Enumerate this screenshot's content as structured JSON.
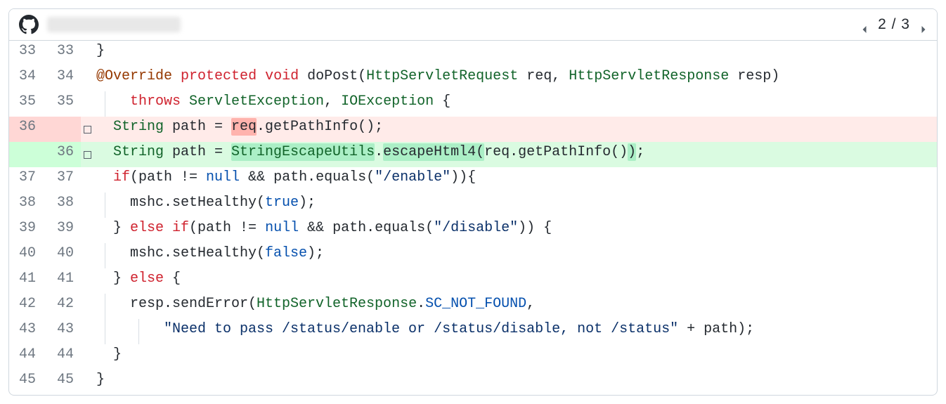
{
  "header": {
    "repo_label": "",
    "pager_prev": "◀",
    "pager_text": "2 / 3",
    "pager_next": "▶"
  },
  "code": {
    "rows": [
      {
        "old": "33",
        "new": "33",
        "type": "ctx",
        "indent": 0,
        "guides": [],
        "tokens": [
          [
            "plain",
            "}"
          ]
        ]
      },
      {
        "old": "34",
        "new": "34",
        "type": "ctx",
        "indent": 0,
        "guides": [],
        "tokens": [
          [
            "ann",
            "@Override"
          ],
          [
            "plain",
            " "
          ],
          [
            "kw",
            "protected"
          ],
          [
            "plain",
            " "
          ],
          [
            "kw",
            "void"
          ],
          [
            "plain",
            " "
          ],
          [
            "fn",
            "doPost"
          ],
          [
            "plain",
            "("
          ],
          [
            "type",
            "HttpServletRequest"
          ],
          [
            "plain",
            " req, "
          ],
          [
            "type",
            "HttpServletResponse"
          ],
          [
            "plain",
            " resp)"
          ]
        ]
      },
      {
        "old": "35",
        "new": "35",
        "type": "ctx",
        "indent": 2,
        "guides": [
          1
        ],
        "tokens": [
          [
            "kw",
            "throws"
          ],
          [
            "plain",
            " "
          ],
          [
            "type",
            "ServletException"
          ],
          [
            "plain",
            ", "
          ],
          [
            "type",
            "IOException"
          ],
          [
            "plain",
            " {"
          ]
        ]
      },
      {
        "old": "36",
        "new": "",
        "type": "del",
        "marker": true,
        "indent": 1,
        "guides": [],
        "tokens": [
          [
            "type",
            "String"
          ],
          [
            "plain",
            " path = "
          ],
          [
            "wdel",
            "req"
          ],
          [
            "plain",
            ".getPathInfo();"
          ]
        ]
      },
      {
        "old": "",
        "new": "36",
        "type": "add",
        "marker": true,
        "indent": 1,
        "guides": [],
        "tokens": [
          [
            "type",
            "String"
          ],
          [
            "plain",
            " path = "
          ],
          [
            "wadd_type",
            "StringEscapeUtils"
          ],
          [
            "plain",
            "."
          ],
          [
            "wadd",
            "escapeHtml4("
          ],
          [
            "plain",
            "req.getPathInfo()"
          ],
          [
            "wadd",
            ")"
          ],
          [
            "plain",
            ";"
          ]
        ]
      },
      {
        "old": "37",
        "new": "37",
        "type": "ctx",
        "indent": 1,
        "guides": [],
        "tokens": [
          [
            "kw",
            "if"
          ],
          [
            "plain",
            "(path != "
          ],
          [
            "bool",
            "null"
          ],
          [
            "plain",
            " && path.equals("
          ],
          [
            "str",
            "\"/enable\""
          ],
          [
            "plain",
            ")){"
          ]
        ]
      },
      {
        "old": "38",
        "new": "38",
        "type": "ctx",
        "indent": 2,
        "guides": [
          1
        ],
        "tokens": [
          [
            "plain",
            "mshc.setHealthy("
          ],
          [
            "bool",
            "true"
          ],
          [
            "plain",
            ");"
          ]
        ]
      },
      {
        "old": "39",
        "new": "39",
        "type": "ctx",
        "indent": 1,
        "guides": [],
        "tokens": [
          [
            "plain",
            "} "
          ],
          [
            "kw",
            "else if"
          ],
          [
            "plain",
            "(path != "
          ],
          [
            "bool",
            "null"
          ],
          [
            "plain",
            " && path.equals("
          ],
          [
            "str",
            "\"/disable\""
          ],
          [
            "plain",
            ")) {"
          ]
        ]
      },
      {
        "old": "40",
        "new": "40",
        "type": "ctx",
        "indent": 2,
        "guides": [
          1
        ],
        "tokens": [
          [
            "plain",
            "mshc.setHealthy("
          ],
          [
            "bool",
            "false"
          ],
          [
            "plain",
            ");"
          ]
        ]
      },
      {
        "old": "41",
        "new": "41",
        "type": "ctx",
        "indent": 1,
        "guides": [],
        "tokens": [
          [
            "plain",
            "} "
          ],
          [
            "kw",
            "else"
          ],
          [
            "plain",
            " {"
          ]
        ]
      },
      {
        "old": "42",
        "new": "42",
        "type": "ctx",
        "indent": 2,
        "guides": [
          1
        ],
        "tokens": [
          [
            "plain",
            "resp.sendError("
          ],
          [
            "type",
            "HttpServletResponse"
          ],
          [
            "plain",
            "."
          ],
          [
            "const",
            "SC_NOT_FOUND"
          ],
          [
            "plain",
            ","
          ]
        ]
      },
      {
        "old": "43",
        "new": "43",
        "type": "ctx",
        "indent": 4,
        "guides": [
          1,
          3
        ],
        "tokens": [
          [
            "str",
            "\"Need to pass /status/enable or /status/disable, not /status\""
          ],
          [
            "plain",
            " + path);"
          ]
        ]
      },
      {
        "old": "44",
        "new": "44",
        "type": "ctx",
        "indent": 1,
        "guides": [],
        "tokens": [
          [
            "plain",
            "}"
          ]
        ]
      },
      {
        "old": "45",
        "new": "45",
        "type": "ctx",
        "indent": 0,
        "guides": [],
        "tokens": [
          [
            "plain",
            "}"
          ]
        ]
      }
    ]
  }
}
